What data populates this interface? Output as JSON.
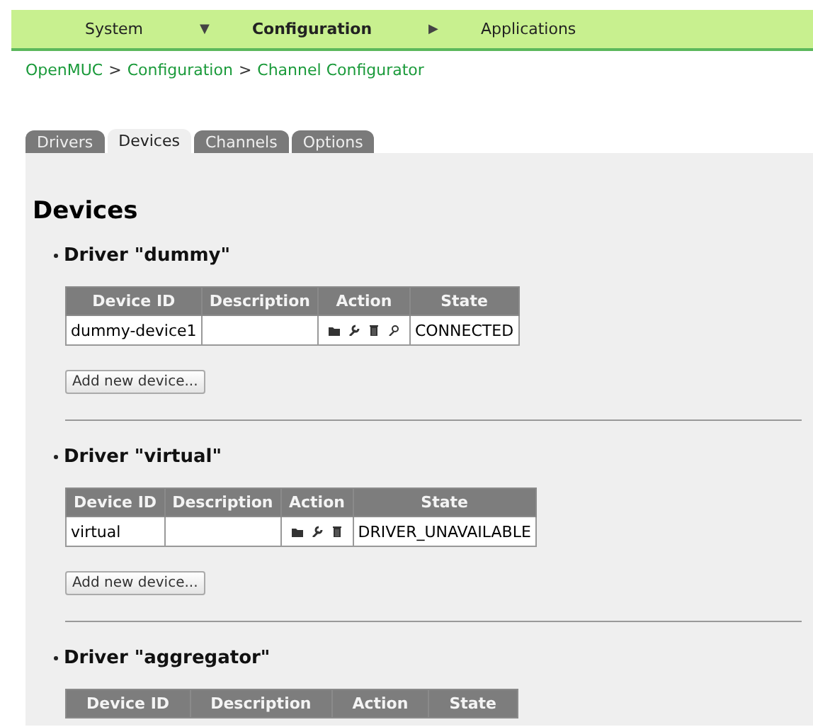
{
  "nav": [
    {
      "label": "System",
      "selected": false
    },
    {
      "label": "Configuration",
      "selected": true,
      "marker": "▼"
    },
    {
      "label": "Applications",
      "selected": false,
      "marker": "▶"
    }
  ],
  "breadcrumb": {
    "separator": ">",
    "items": [
      "OpenMUC",
      "Configuration",
      "Channel Configurator"
    ]
  },
  "tabs": [
    {
      "label": "Drivers",
      "selected": false
    },
    {
      "label": "Devices",
      "selected": true
    },
    {
      "label": "Channels",
      "selected": false
    },
    {
      "label": "Options",
      "selected": false
    }
  ],
  "heading": "Devices",
  "drivers": [
    {
      "title": "Driver \"dummy\"",
      "columns": [
        "Device ID",
        "Description",
        "Action",
        "State"
      ],
      "rows": [
        {
          "device_id": "dummy-device1",
          "search_action": true,
          "state": "CONNECTED"
        }
      ],
      "button": "Add new device..."
    },
    {
      "title": "Driver \"virtual\"",
      "columns": [
        "Device ID",
        "Description",
        "Action",
        "State"
      ],
      "rows": [
        {
          "device_id": "virtual",
          "search_action": false,
          "state": "DRIVER_UNAVAILABLE"
        }
      ],
      "button": "Add new device..."
    },
    {
      "title": "Driver \"aggregator\"",
      "columns": [
        "Device ID",
        "Description",
        "Action",
        "State"
      ]
    }
  ]
}
